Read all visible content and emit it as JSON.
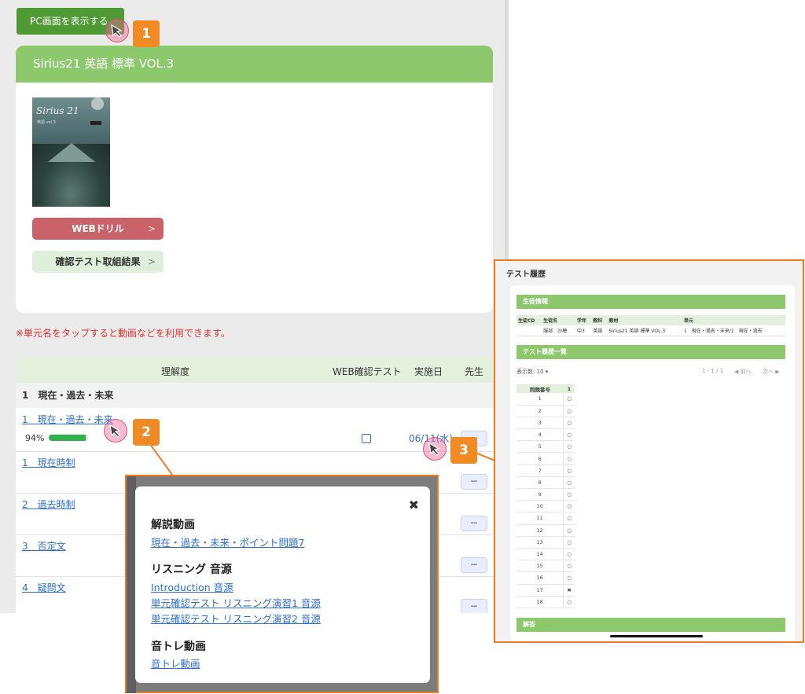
{
  "top": {
    "pc_button": "PC画面を表示する"
  },
  "book": {
    "title": "Sirius21 英語 標準 VOL.3",
    "cover_title": "Sirius 21",
    "cover_subtitle": "英語 vol.3",
    "web_drill": "WEBドリル",
    "confirm_results": "確認テスト取組結果"
  },
  "notice": "※単元名をタップすると動画などを利用できます。",
  "table": {
    "headers": {
      "understanding": "理解度",
      "web_test": "WEB確認テスト",
      "date": "実施日",
      "teacher": "先生"
    },
    "unit_header": "1　現在・過去・未来",
    "main_row": {
      "link": "1　現在・過去・未来",
      "percent_text": "94%",
      "percent": 94,
      "date": "06/11(水)",
      "btn": "－"
    },
    "subrows": [
      {
        "link": "1　現在時制",
        "btn": "－"
      },
      {
        "link": "2　過去時制",
        "btn": "－"
      },
      {
        "link": "3　否定文",
        "btn": "－"
      },
      {
        "link": "4　疑問文",
        "btn": "－"
      }
    ]
  },
  "callouts": [
    "1",
    "2",
    "3"
  ],
  "popup": {
    "close": "✖",
    "sections": [
      {
        "title": "解説動画",
        "links": [
          "現在・過去・未来・ポイント問題7"
        ]
      },
      {
        "title": "リスニング 音源",
        "links": [
          "Introduction 音源",
          "単元確認テスト リスニング演習1 音源",
          "単元確認テスト リスニング演習2 音源"
        ]
      },
      {
        "title": "音トレ動画",
        "links": [
          "音トレ動画"
        ]
      }
    ]
  },
  "test_history": {
    "title": "テスト履歴",
    "student_info_heading": "生徒情報",
    "student_info_headers": [
      "生徒CD",
      "生徒名",
      "学年",
      "教科",
      "教材",
      "単元"
    ],
    "student_info_row": [
      "",
      "服部　沙穂",
      "中3",
      "英語",
      "Sirius21 英語 標準 VOL.3",
      "1　現在・過去・未来/1　現在・過去"
    ],
    "history_heading": "テスト履歴一覧",
    "display_count": "表示数: 10",
    "pager": {
      "range": "1 - 1 / 1",
      "prev": "◀ 前へ",
      "next": "次へ ▶"
    },
    "question_headers": [
      "問題番号",
      "1"
    ],
    "questions": [
      {
        "no": "1",
        "result": "○"
      },
      {
        "no": "2",
        "result": "○"
      },
      {
        "no": "3",
        "result": "○"
      },
      {
        "no": "4",
        "result": "○"
      },
      {
        "no": "5",
        "result": "○"
      },
      {
        "no": "6",
        "result": "○"
      },
      {
        "no": "7",
        "result": "○"
      },
      {
        "no": "8",
        "result": "○"
      },
      {
        "no": "9",
        "result": "○"
      },
      {
        "no": "10",
        "result": "○"
      },
      {
        "no": "11",
        "result": "○"
      },
      {
        "no": "12",
        "result": "○"
      },
      {
        "no": "13",
        "result": "○"
      },
      {
        "no": "14",
        "result": "○"
      },
      {
        "no": "15",
        "result": "○"
      },
      {
        "no": "16",
        "result": "○"
      },
      {
        "no": "17",
        "result": "✖"
      },
      {
        "no": "18",
        "result": "○"
      }
    ],
    "answer_heading": "解答"
  },
  "colors": {
    "accent_green": "#8cc86c",
    "orange": "#ee7a22",
    "link_blue": "#2d6ed3",
    "notice_red": "#e23232"
  }
}
